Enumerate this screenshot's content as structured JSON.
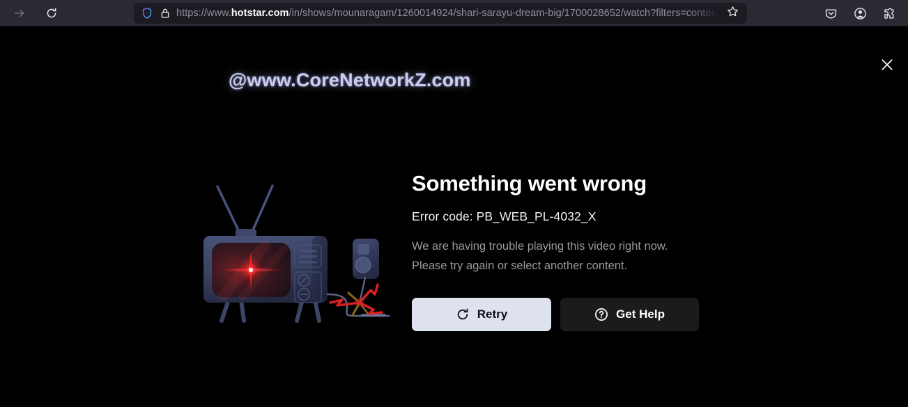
{
  "browser": {
    "forward_icon": "forward-arrow-icon",
    "reload_icon": "reload-icon",
    "shield_icon": "shield-tracking-protection-icon",
    "lock_icon": "padlock-icon",
    "url_prefix": "https://www.",
    "url_domain": "hotstar.com",
    "url_suffix": "/in/shows/mounaragam/1260014924/shari-sarayu-dream-big/1700028652/watch?filters=content_type",
    "star_icon": "bookmark-star-icon",
    "pocket_icon": "pocket-icon",
    "account_icon": "account-avatar-icon",
    "extensions_icon": "extensions-puzzle-icon"
  },
  "page": {
    "watermark": "@www.CoreNetworkZ.com",
    "close_icon": "close-x-icon"
  },
  "error": {
    "title": "Something went wrong",
    "code": "Error code: PB_WEB_PL-4032_X",
    "description": "We are having trouble playing this video right now. Please try again or select another content.",
    "retry_label": "Retry",
    "retry_icon": "refresh-icon",
    "help_label": "Get Help",
    "help_icon": "question-circle-icon",
    "illustration": "broken-tv-with-sparking-plug-illustration"
  },
  "colors": {
    "page_background": "#000000",
    "toolbar_background": "#2b2a33",
    "urlbar_background": "#1c1b22",
    "watermark": "#c9cdf2",
    "title": "#ffffff",
    "description": "#9a9a9a",
    "retry_button": "#dde2ee",
    "help_button": "#1b1b1b",
    "tv_body": "#3d4663",
    "screen_glow": "#ff1a1a",
    "spark": "#e02020"
  }
}
